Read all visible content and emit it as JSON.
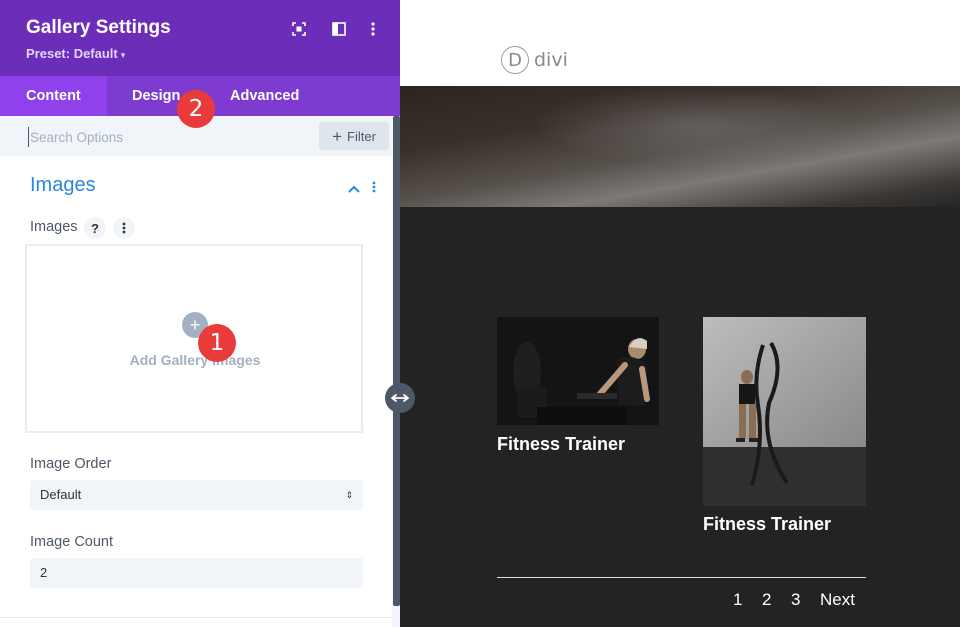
{
  "panel": {
    "title": "Gallery Settings",
    "preset": "Preset: Default",
    "tabs": [
      {
        "label": "Content",
        "active": true
      },
      {
        "label": "Design",
        "active": false
      },
      {
        "label": "Advanced",
        "active": false
      }
    ],
    "search_placeholder": "Search Options",
    "filter_label": "Filter",
    "section_title": "Images",
    "images_label": "Images",
    "help_symbol": "?",
    "add_gallery_label": "Add Gallery Images",
    "image_order_label": "Image Order",
    "image_order_value": "Default",
    "image_count_label": "Image Count",
    "image_count_value": "2"
  },
  "badges": [
    "1",
    "2"
  ],
  "preview": {
    "logo_letter": "D",
    "logo_text": "divi",
    "items": [
      {
        "title": "Fitness Trainer"
      },
      {
        "title": "Fitness Trainer"
      }
    ],
    "pagination": [
      "1",
      "2",
      "3",
      "Next"
    ]
  },
  "colors": {
    "header_purple": "#6c2eb9",
    "tab_purple": "#7d3bcf",
    "active_tab": "#8f42ec",
    "section_blue": "#2b87da",
    "badge_red": "#ea3b3b",
    "preview_dark": "#232323"
  },
  "icons": [
    "fullscreen-icon",
    "split-view-icon",
    "more-vert-icon",
    "chevron-up-icon",
    "plus-icon",
    "resize-arrows-icon",
    "select-arrows-icon"
  ]
}
